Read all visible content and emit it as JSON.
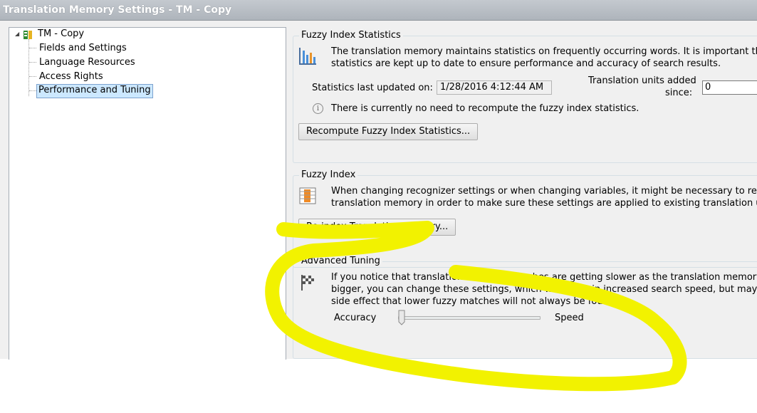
{
  "window": {
    "title": "Translation Memory Settings - TM - Copy"
  },
  "tree": {
    "root_label": "TM - Copy",
    "items": [
      {
        "label": "Fields and Settings"
      },
      {
        "label": "Language Resources"
      },
      {
        "label": "Access Rights"
      },
      {
        "label": "Performance and Tuning",
        "selected": true
      }
    ]
  },
  "fuzzy_index_statistics": {
    "title": "Fuzzy Index Statistics",
    "description_line1": "The translation memory maintains statistics on frequently occurring words. It is important tha",
    "description_line2": "statistics are kept up to date to ensure performance and accuracy of search results.",
    "last_updated_label": "Statistics last updated on:",
    "last_updated_value": "1/28/2016 4:12:44 AM",
    "tu_added_label_line1": "Translation units added",
    "tu_added_label_line2": "since:",
    "tu_added_value": "0",
    "info_message": "There is currently no need to recompute the fuzzy index statistics.",
    "recompute_button": "Recompute Fuzzy Index Statistics..."
  },
  "fuzzy_index": {
    "title": "Fuzzy Index",
    "description_line1": "When changing recognizer settings or when changing variables, it might be necessary to re",
    "description_line2": "translation memory in order to make sure these settings are applied to existing translation u",
    "reindex_button": "Re-index Translation Memory..."
  },
  "advanced_tuning": {
    "title": "Advanced Tuning",
    "description_line1": "If you notice that translation memory searches are getting slower as the translation memory",
    "description_line2": "bigger, you can change these settings, which will result in increased search speed, but may",
    "description_line3": "side effect that lower fuzzy matches will not always be found.",
    "slider_left_label": "Accuracy",
    "slider_right_label": "Speed",
    "slider_value_fraction": 0.0
  },
  "annotation": {
    "color": "#f2f200"
  }
}
